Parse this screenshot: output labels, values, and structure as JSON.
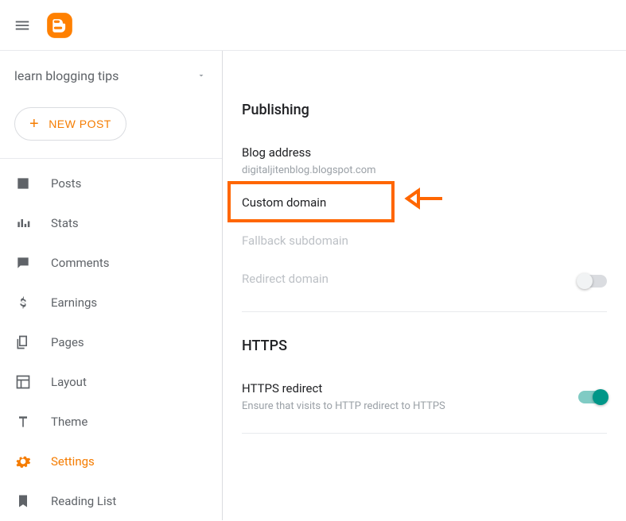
{
  "header": {
    "blog_name": "learn blogging tips"
  },
  "new_post_label": "NEW POST",
  "nav": {
    "items": [
      {
        "label": "Posts"
      },
      {
        "label": "Stats"
      },
      {
        "label": "Comments"
      },
      {
        "label": "Earnings"
      },
      {
        "label": "Pages"
      },
      {
        "label": "Layout"
      },
      {
        "label": "Theme"
      },
      {
        "label": "Settings"
      },
      {
        "label": "Reading List"
      }
    ]
  },
  "publishing": {
    "heading": "Publishing",
    "blog_address_label": "Blog address",
    "blog_address_value": "digitaljitenblog.blogspot.com",
    "custom_domain_label": "Custom domain",
    "fallback_label": "Fallback subdomain",
    "redirect_label": "Redirect domain"
  },
  "https": {
    "heading": "HTTPS",
    "redirect_label": "HTTPS redirect",
    "redirect_desc": "Ensure that visits to HTTP redirect to HTTPS"
  }
}
